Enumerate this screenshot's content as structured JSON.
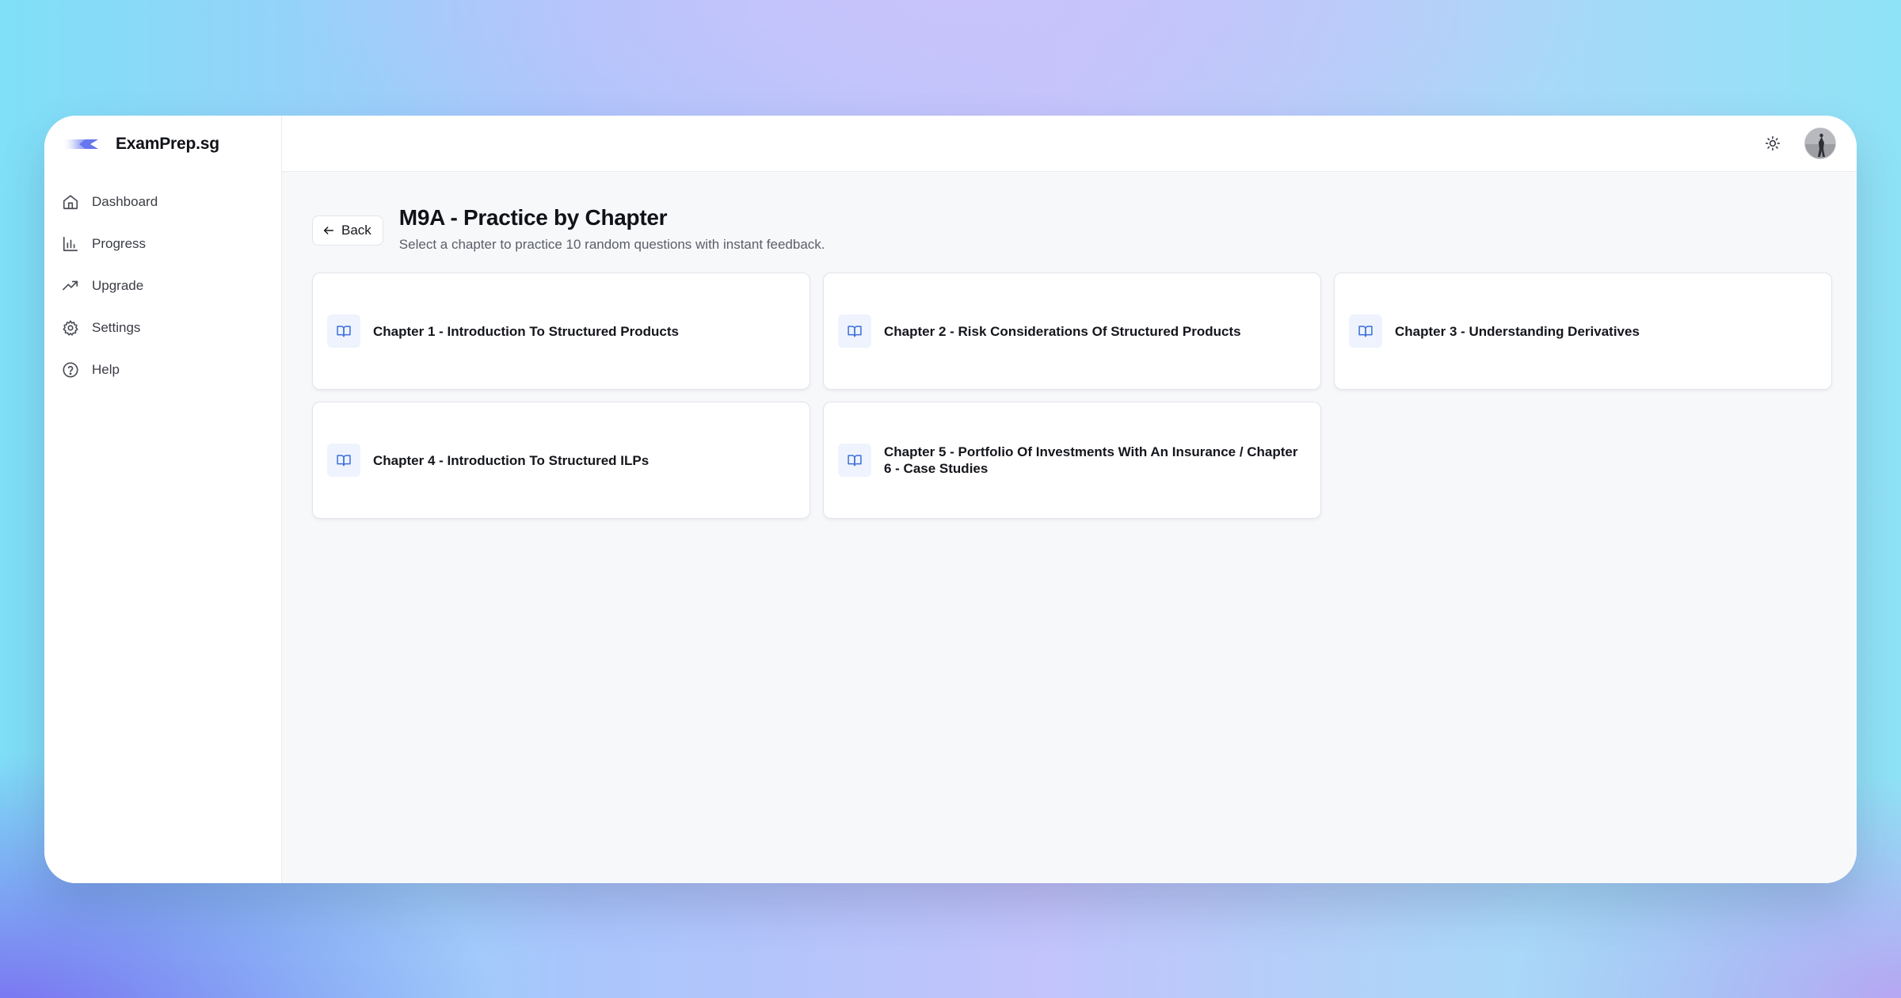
{
  "app": {
    "brand_name": "ExamPrep.sg",
    "brand_logo_icon": "brand-logo-icon"
  },
  "sidebar": {
    "items": [
      {
        "label": "Dashboard",
        "icon": "home-icon"
      },
      {
        "label": "Progress",
        "icon": "bar-chart-icon"
      },
      {
        "label": "Upgrade",
        "icon": "trending-up-icon"
      },
      {
        "label": "Settings",
        "icon": "gear-icon"
      },
      {
        "label": "Help",
        "icon": "help-circle-icon"
      }
    ]
  },
  "topbar": {
    "theme_icon": "sun-icon",
    "avatar_icon": "user-avatar"
  },
  "page": {
    "back_label": "Back",
    "title": "M9A - Practice by Chapter",
    "subtitle": "Select a chapter to practice 10 random questions with instant feedback."
  },
  "chapters": [
    {
      "title": "Chapter 1 - Introduction To Structured Products",
      "icon": "book-open-icon"
    },
    {
      "title": "Chapter 2 - Risk Considerations Of Structured Products",
      "icon": "book-open-icon"
    },
    {
      "title": "Chapter 3 - Understanding Derivatives",
      "icon": "book-open-icon"
    },
    {
      "title": "Chapter 4 - Introduction To Structured ILPs",
      "icon": "book-open-icon"
    },
    {
      "title": "Chapter 5 - Portfolio Of Investments With An Insurance / Chapter 6 - Case Studies",
      "icon": "book-open-icon"
    }
  ],
  "colors": {
    "accent": "#3b6fd8",
    "icon_bg": "#eef3fd",
    "text_primary": "#111218",
    "text_secondary": "#5b5e69"
  }
}
